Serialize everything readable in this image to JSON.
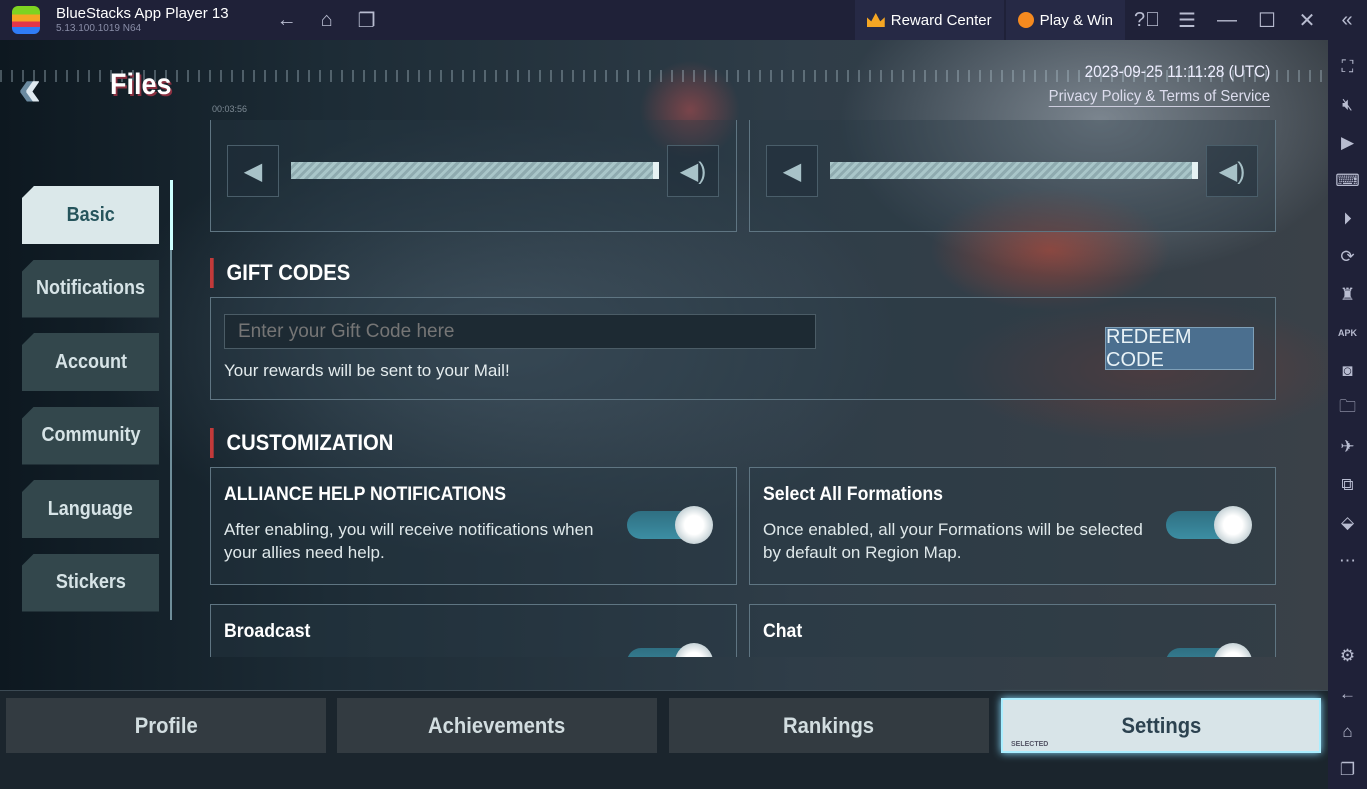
{
  "window": {
    "title": "BlueStacks App Player 13",
    "version": "5.13.100.1019  N64",
    "reward_center": "Reward Center",
    "play_win": "Play & Win"
  },
  "header": {
    "title": "Files",
    "clock": "00:03:56",
    "datetime": "2023-09-25 11:11:28 (UTC)",
    "privacy_link": "Privacy Policy & Terms of Service"
  },
  "left_tabs": [
    {
      "label": "Basic",
      "active": true
    },
    {
      "label": "Notifications"
    },
    {
      "label": "Account"
    },
    {
      "label": "Community"
    },
    {
      "label": "Language"
    },
    {
      "label": "Stickers"
    }
  ],
  "volume": {
    "music_level": 100,
    "sound_level": 100
  },
  "gift_codes": {
    "title": "GIFT CODES",
    "placeholder": "Enter your Gift Code here",
    "note": "Your rewards will be sent to your Mail!",
    "redeem_label": "REDEEM CODE"
  },
  "customization": {
    "title": "CUSTOMIZATION",
    "cards": [
      {
        "title": "ALLIANCE HELP NOTIFICATIONS",
        "desc": "After enabling, you will receive notifications when your allies need help.",
        "on": true
      },
      {
        "title": "Select All Formations",
        "desc": "Once enabled, all your Formations will be selected by default on Region Map.",
        "on": true
      },
      {
        "title": "Broadcast",
        "desc": "",
        "on": true
      },
      {
        "title": "Chat",
        "desc": "",
        "on": true
      }
    ]
  },
  "bottom_tabs": [
    {
      "label": "Profile"
    },
    {
      "label": "Achievements"
    },
    {
      "label": "Rankings"
    },
    {
      "label": "Settings",
      "active": true,
      "badge": "SELECTED"
    }
  ],
  "colors": {
    "accent_red": "#c23a3a",
    "toggle_on": "#3c8ea3",
    "chrome": "#1f2138"
  }
}
